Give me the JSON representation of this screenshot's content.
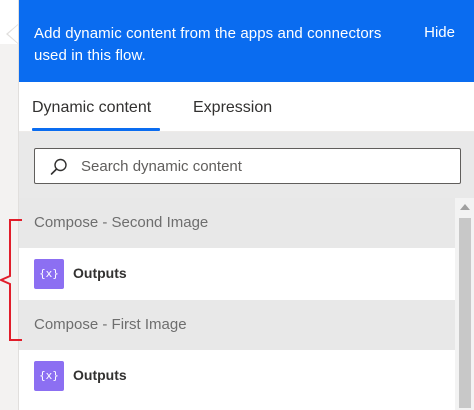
{
  "banner": {
    "message": "Add dynamic content from the apps and connectors used in this flow.",
    "hide_label": "Hide"
  },
  "tabs": [
    {
      "label": "Dynamic content",
      "active": true
    },
    {
      "label": "Expression",
      "active": false
    }
  ],
  "search": {
    "placeholder": "Search dynamic content",
    "value": ""
  },
  "groups": [
    {
      "header": "Compose - Second Image",
      "items": [
        {
          "label": "Outputs",
          "icon": "compose-icon"
        }
      ]
    },
    {
      "header": "Compose - First Image",
      "items": [
        {
          "label": "Outputs",
          "icon": "compose-icon"
        }
      ]
    }
  ],
  "icon_glyph": "{x}",
  "colors": {
    "accent": "#0a6cf0",
    "compose_icon": "#8c6ff2",
    "annotation": "#e11d2a"
  }
}
